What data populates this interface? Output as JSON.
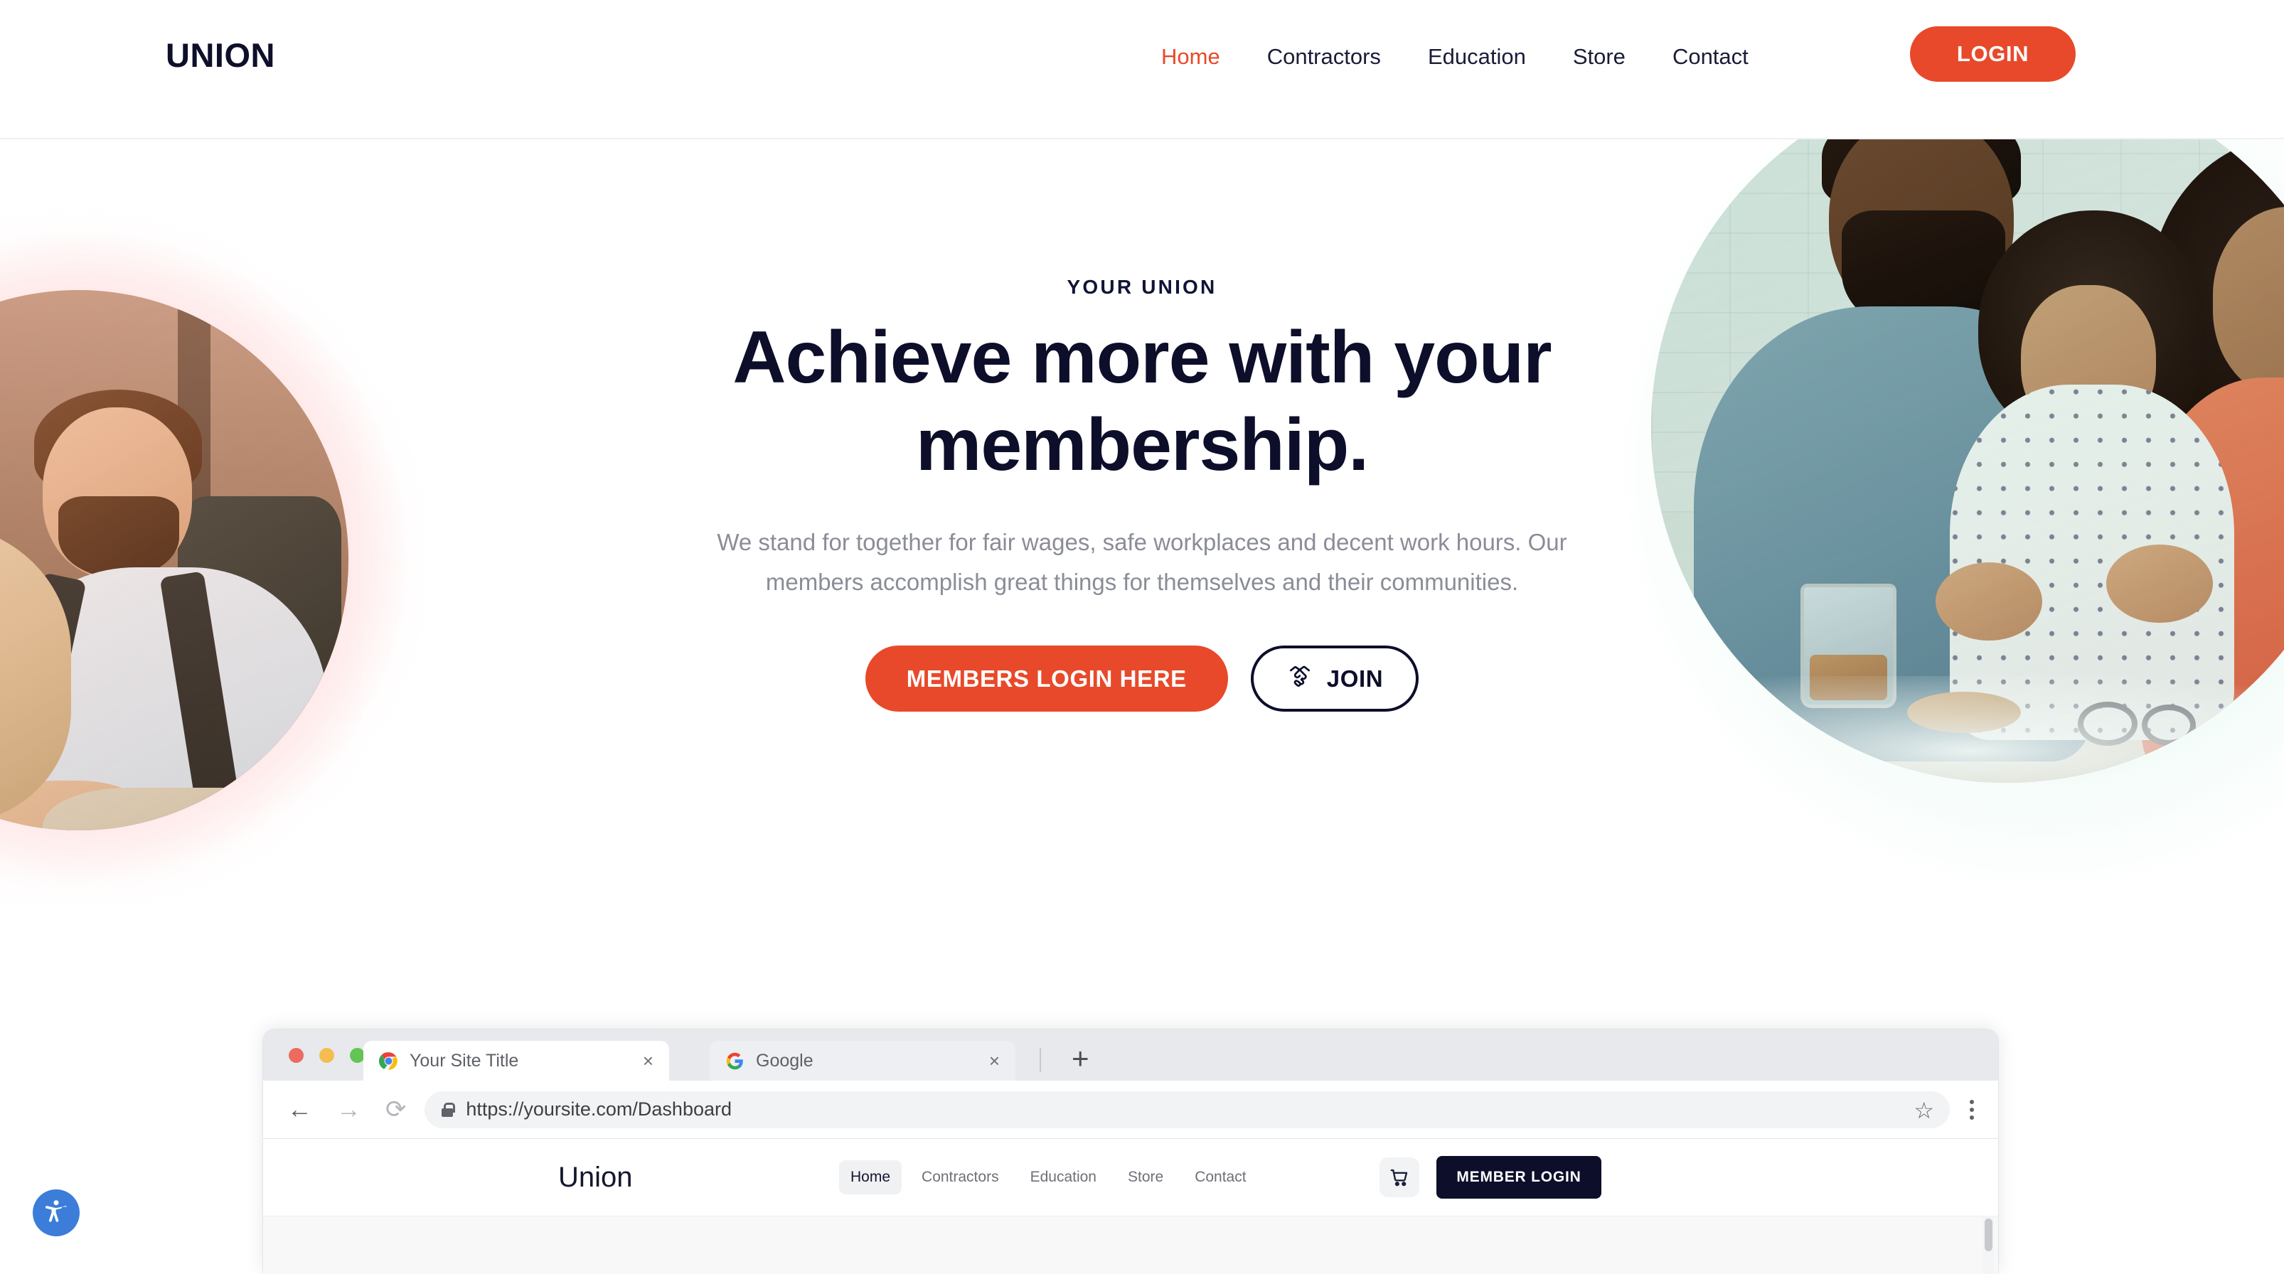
{
  "header": {
    "logo": "UNION",
    "nav": [
      {
        "label": "Home",
        "active": true
      },
      {
        "label": "Contractors",
        "active": false
      },
      {
        "label": "Education",
        "active": false
      },
      {
        "label": "Store",
        "active": false
      },
      {
        "label": "Contact",
        "active": false
      }
    ],
    "login_label": "LOGIN"
  },
  "hero": {
    "eyebrow": "YOUR UNION",
    "title": "Achieve more with your membership.",
    "subtitle": "We stand for together for fair wages, safe workplaces and decent work hours. Our members accomplish great things for themselves and their communities.",
    "cta_primary": "MEMBERS LOGIN HERE",
    "cta_secondary": "JOIN",
    "left_image_alt": "man-with-dog-photo",
    "right_image_alt": "family-baking-photo"
  },
  "browser": {
    "tabs": [
      {
        "title": "Your Site Title",
        "favicon": "chrome-icon",
        "close": "×",
        "active": true
      },
      {
        "title": "Google",
        "favicon": "google-icon",
        "close": "×",
        "active": false
      }
    ],
    "new_tab": "+",
    "back": "←",
    "forward": "→",
    "reload": "⟳",
    "url": "https://yoursite.com/Dashboard",
    "bookmark": "☆"
  },
  "mocksite": {
    "logo": "Union",
    "nav": [
      {
        "label": "Home",
        "active": true
      },
      {
        "label": "Contractors",
        "active": false
      },
      {
        "label": "Education",
        "active": false
      },
      {
        "label": "Store",
        "active": false
      },
      {
        "label": "Contact",
        "active": false
      }
    ],
    "cart_icon": "shopping-cart-icon",
    "login_label": "MEMBER LOGIN"
  },
  "accessibility": {
    "icon": "accessibility-person-icon",
    "color": "#3b7dd8"
  },
  "colors": {
    "accent_orange": "#e8492a",
    "ink_navy": "#0c0e2a",
    "muted_text": "#8a8d97"
  }
}
